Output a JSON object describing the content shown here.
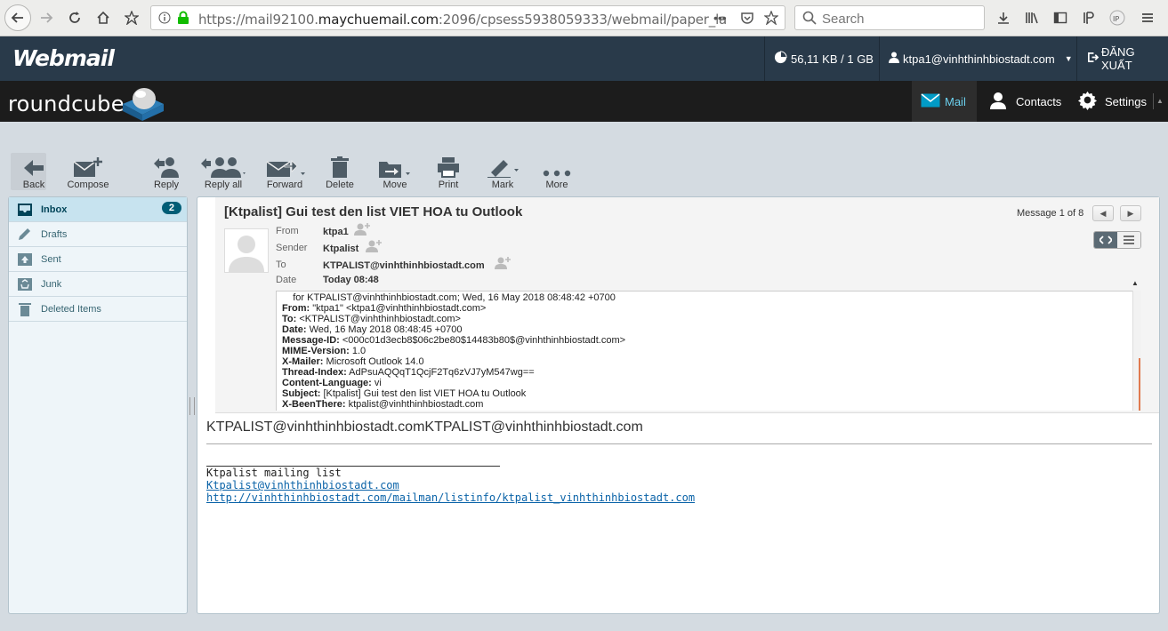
{
  "browser": {
    "url_prefix": "https://mail92100.",
    "url_domain": "maychuemail.com",
    "url_suffix": ":2096/cpsess5938059333/webmail/paper_la",
    "url_more": "•••",
    "search_placeholder": "Search"
  },
  "cpanel": {
    "logo": "Webmail",
    "quota": "56,11 KB / 1 GB",
    "user": "ktpa1@vinhthinhbiostadt.com",
    "logout": "ĐĂNG XUẤT"
  },
  "roundcube": {
    "logo": "roundcube",
    "tabs": {
      "mail": "Mail",
      "contacts": "Contacts",
      "settings": "Settings"
    }
  },
  "toolbar": {
    "back": "Back",
    "compose": "Compose",
    "reply": "Reply",
    "reply_all": "Reply all",
    "forward": "Forward",
    "delete": "Delete",
    "move": "Move",
    "print": "Print",
    "mark": "Mark",
    "more": "More"
  },
  "folders": [
    {
      "label": "Inbox",
      "unread": "2"
    },
    {
      "label": "Drafts"
    },
    {
      "label": "Sent"
    },
    {
      "label": "Junk"
    },
    {
      "label": "Deleted Items"
    }
  ],
  "message": {
    "subject": "[Ktpalist] Gui test den list VIET HOA tu Outlook",
    "counter": "Message 1 of 8",
    "headers": {
      "from_label": "From",
      "from_value": "ktpa1",
      "sender_label": "Sender",
      "sender_value": "Ktpalist",
      "to_label": "To",
      "to_value": "KTPALIST@vinhthinhbiostadt.com",
      "date_label": "Date",
      "date_value": "Today 08:48"
    },
    "raw_headers": [
      {
        "key": "",
        "value": "    for KTPALIST@vinhthinhbiostadt.com; Wed, 16 May 2018 08:48:42 +0700"
      },
      {
        "key": "From:",
        "value": " \"ktpa1\" <ktpa1@vinhthinhbiostadt.com>"
      },
      {
        "key": "To:",
        "value": " <KTPALIST@vinhthinhbiostadt.com>"
      },
      {
        "key": "Date:",
        "value": " Wed, 16 May 2018 08:48:45 +0700"
      },
      {
        "key": "Message-ID:",
        "value": " <000c01d3ecb8$06c2be80$14483b80$@vinhthinhbiostadt.com>"
      },
      {
        "key": "MIME-Version:",
        "value": " 1.0"
      },
      {
        "key": "X-Mailer:",
        "value": " Microsoft Outlook 14.0"
      },
      {
        "key": "Thread-Index:",
        "value": " AdPsuAQQqT1QcjF2Tq6zVJ7yM547wg=="
      },
      {
        "key": "Content-Language:",
        "value": " vi"
      },
      {
        "key": "Subject:",
        "value": " [Ktpalist] Gui test den list VIET HOA tu Outlook"
      },
      {
        "key": "X-BeenThere:",
        "value": " ktpalist@vinhthinhbiostadt.com"
      }
    ],
    "body": {
      "title": "KTPALIST@vinhthinhbiostadt.comKTPALIST@vinhthinhbiostadt.com",
      "list_name": "Ktpalist mailing list",
      "list_email": "Ktpalist@vinhthinhbiostadt.com",
      "list_url": "http://vinhthinhbiostadt.com/mailman/listinfo/ktpalist_vinhthinhbiostadt.com"
    }
  },
  "colors": {
    "cpanel_bg": "#293a4a",
    "roundcube_bg": "#1c1c1c",
    "accent": "#019bc6",
    "badge": "#005d76",
    "link": "#0a63a8"
  }
}
